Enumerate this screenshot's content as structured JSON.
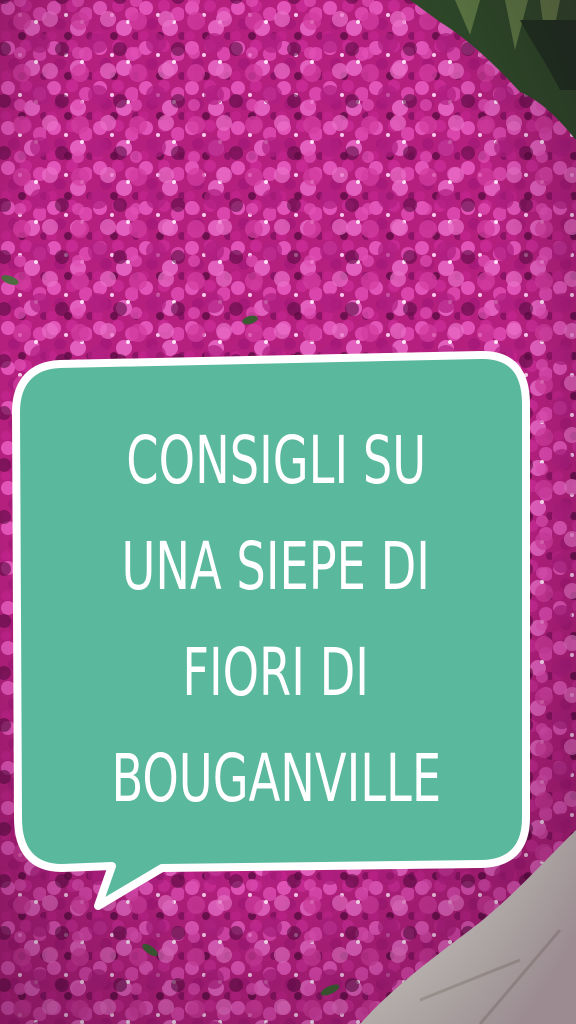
{
  "story": {
    "caption_lines": [
      "CONSIGLI SU",
      "UNA SIEPE DI",
      "FIORI DI",
      "BOUGANVILLE"
    ]
  },
  "colors": {
    "bubble_fill": "#5ab89c",
    "bubble_border": "#ffffff",
    "flower_main": "#c2268e",
    "flower_light": "#e04fb4",
    "flower_dark": "#6e1050",
    "leaf": "#2f4a2a",
    "pavement": "#d9d6cf"
  }
}
